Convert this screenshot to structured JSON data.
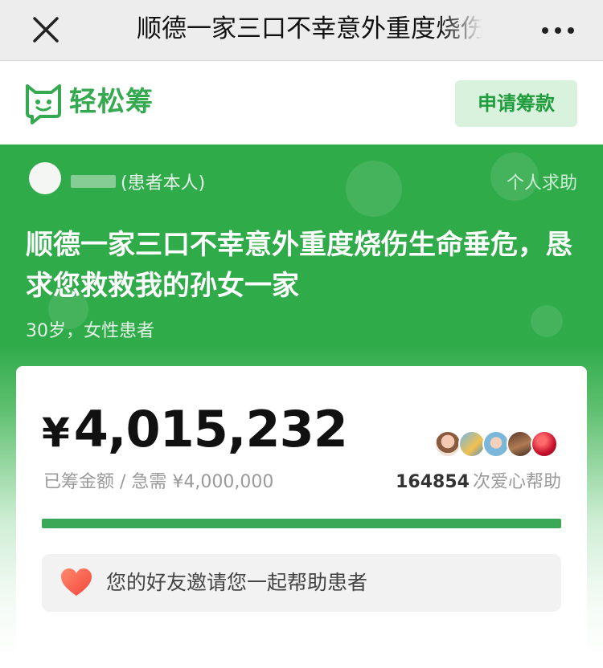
{
  "navbar": {
    "title": "顺德一家三口不幸意外重度烧伤生命垂危，恳求您救救我的孙女一家"
  },
  "brand": {
    "name": "轻松筹",
    "apply_button": "申请筹款",
    "color": "#35a94f"
  },
  "campaign": {
    "author_role": "(患者本人)",
    "help_type": "个人求助",
    "title": "顺德一家三口不幸意外重度烧伤生命垂危，恳求您救救我的孙女一家",
    "patient_info": "30岁，女性患者"
  },
  "stats": {
    "currency": "¥",
    "raised": "4,015,232",
    "raised_label": "已筹金额 / 急需 ¥4,000,000",
    "progress_percent": 100,
    "supporter_count": "164854",
    "supporter_label": "次爱心帮助"
  },
  "invite": {
    "text": "您的好友邀请您一起帮助患者"
  },
  "icons": [
    "close-icon",
    "more-icon",
    "brand-logo-icon",
    "heart-icon"
  ],
  "colors": {
    "hero_green": "#2fab4a",
    "progress": "#3aa856",
    "apply_bg": "#d9f2dd"
  }
}
